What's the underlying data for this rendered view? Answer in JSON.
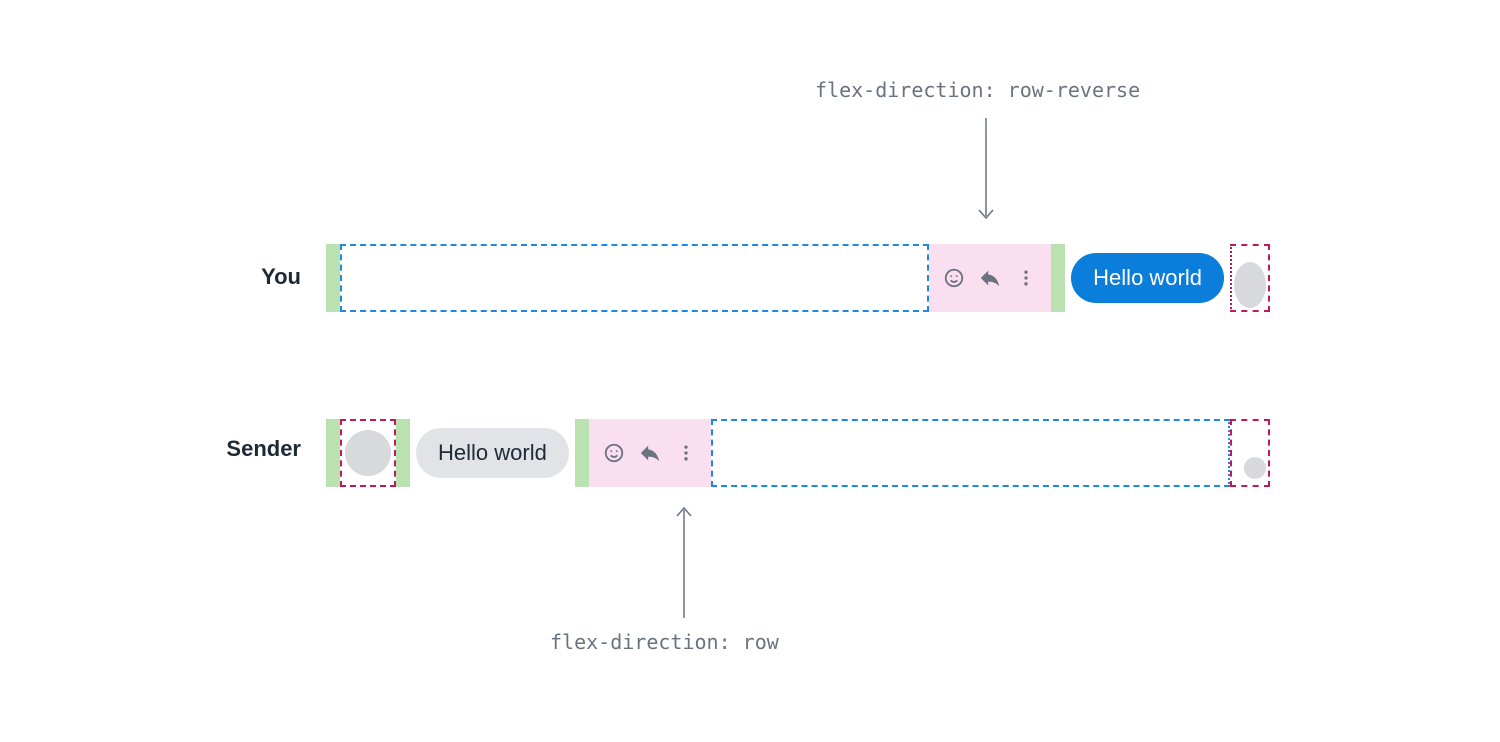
{
  "annotations": {
    "top": "flex-direction: row-reverse",
    "bottom": "flex-direction: row"
  },
  "labels": {
    "you": "You",
    "sender": "Sender"
  },
  "messages": {
    "you": {
      "text": "Hello world"
    },
    "sender": {
      "text": "Hello world"
    }
  },
  "icons": {
    "more": "more-vertical-icon",
    "reply": "reply-icon",
    "emoji": "emoji-smile-icon"
  },
  "colors": {
    "bubble_you_bg": "#0b7dda",
    "bubble_you_fg": "#ffffff",
    "bubble_sender_bg": "#e1e3e6",
    "bubble_sender_fg": "#1f2937",
    "actions_bg": "#fadff1",
    "green_strip": "#b9e2b0",
    "dashed_blue": "#1e88e5",
    "dashed_magenta": "#c2185b",
    "annotation_text": "#6b7280"
  }
}
